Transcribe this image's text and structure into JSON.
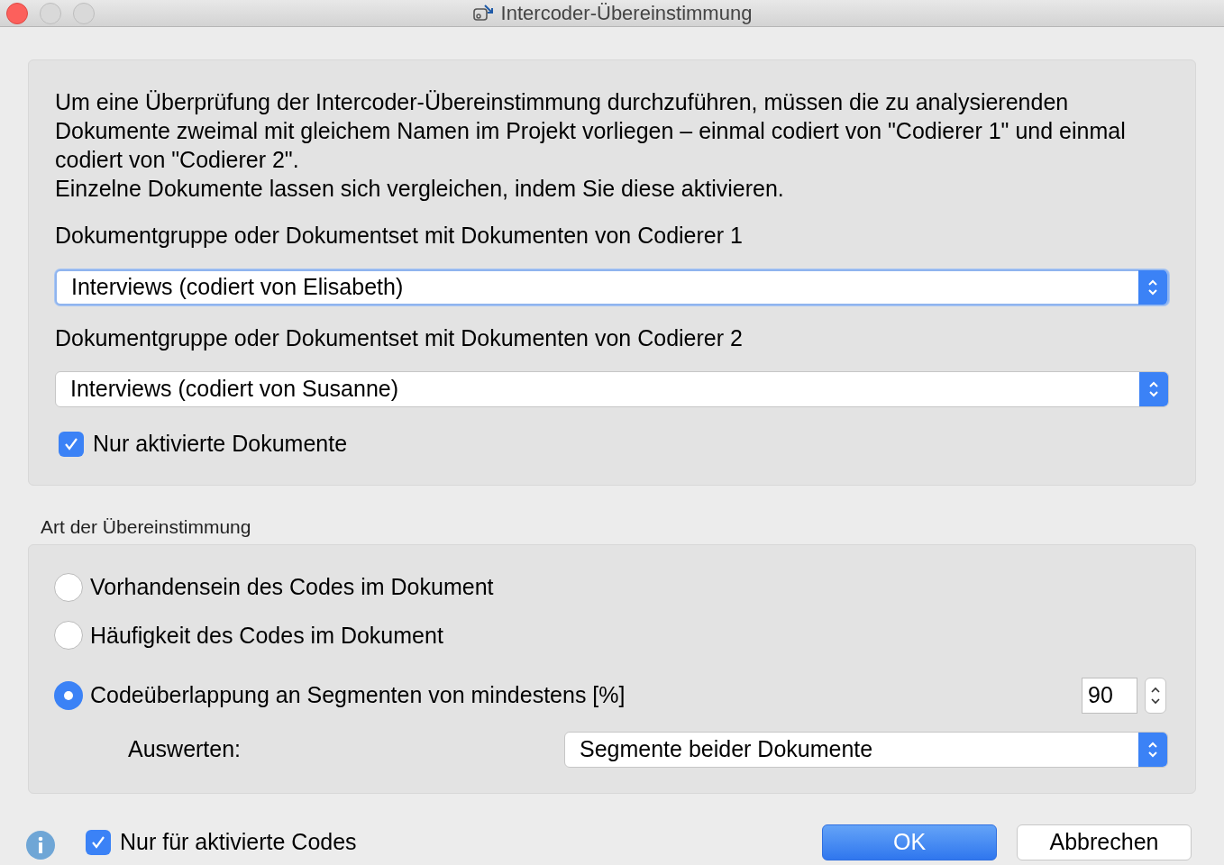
{
  "window": {
    "title": "Intercoder-Übereinstimmung"
  },
  "intro": [
    "Um eine Überprüfung der Intercoder-Übereinstimmung durchzuführen, müssen die zu analysierenden Dokumente zweimal mit gleichem Namen im Projekt vorliegen – einmal codiert von \"Codierer 1\" und einmal codiert von \"Codierer 2\".",
    "Einzelne Dokumente lassen sich vergleichen, indem Sie diese aktivieren."
  ],
  "selects": [
    {
      "label": "Dokumentgruppe oder Dokumentset mit Dokumenten von Codierer 1",
      "value": "Interviews (codiert von Elisabeth)",
      "focused": true
    },
    {
      "label": "Dokumentgruppe oder Dokumentset mit Dokumenten von Codierer 2",
      "value": "Interviews (codiert von Susanne)",
      "focused": false
    }
  ],
  "only_active_documents": {
    "label": "Nur aktivierte Dokumente",
    "checked": true
  },
  "agreement": {
    "title": "Art der Übereinstimmung",
    "options": [
      {
        "label": "Vorhandensein des Codes im Dokument",
        "selected": false
      },
      {
        "label": "Häufigkeit des Codes im Dokument",
        "selected": false
      },
      {
        "label": "Codeüberlappung an Segmenten von mindestens [%]",
        "selected": true
      }
    ],
    "percent": "90",
    "evaluate_label": "Auswerten:",
    "evaluate_value": "Segmente beider Dokumente"
  },
  "only_active_codes": {
    "label": "Nur für aktivierte Codes",
    "checked": true
  },
  "buttons": [
    {
      "label": "OK",
      "kind": "primary"
    },
    {
      "label": "Abbrechen",
      "kind": "secondary"
    }
  ]
}
